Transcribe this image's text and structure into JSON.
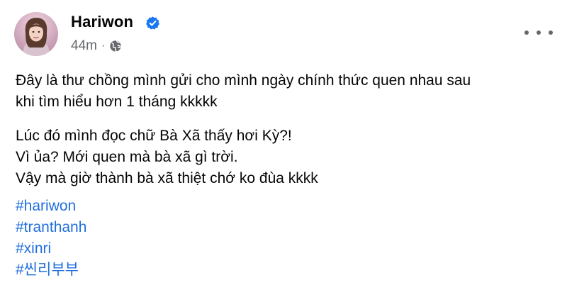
{
  "post": {
    "author": {
      "name": "Hariwon",
      "verified_icon": "verified-badge-icon",
      "avatar_icon": "profile-photo"
    },
    "meta": {
      "time": "44m",
      "separator": "·",
      "audience_icon": "globe-icon"
    },
    "more_icon": "more-horizontal-icon",
    "paragraphs": [
      {
        "lines": [
          "Đây là thư chồng mình gửi cho mình ngày chính thức quen nhau sau",
          "khi tìm hiểu hơn 1 tháng kkkkk"
        ]
      },
      {
        "lines": [
          "Lúc đó mình đọc chữ Bà Xã thấy hơi Kỳ?!",
          "Vì ủa? Mới quen mà bà xã gì trời.",
          "Vậy mà giờ thành bà xã thiệt chớ ko đùa kkkk"
        ]
      }
    ],
    "hashtags": [
      "#hariwon",
      "#tranthanh",
      "#xinri",
      "#씬리부부"
    ],
    "colors": {
      "link": "#216fdb",
      "verified": "#1877f2",
      "secondary_text": "#65676b"
    }
  }
}
